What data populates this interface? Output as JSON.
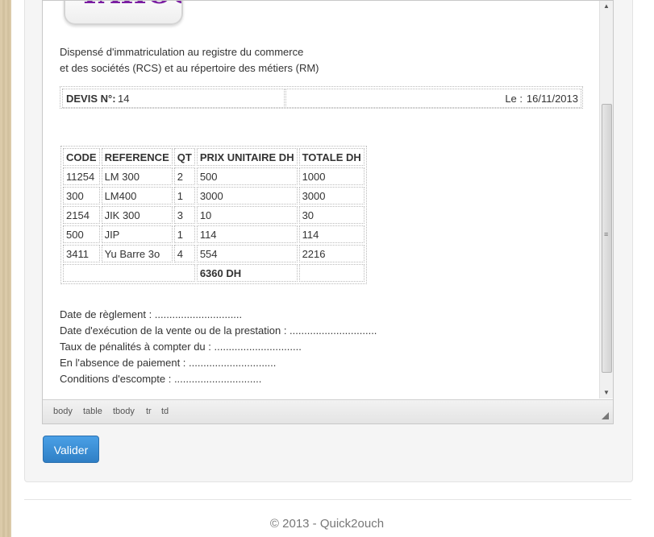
{
  "company": {
    "logo_text": "YAHOO!",
    "line1": "Dispensé d'immatriculation au registre du commerce",
    "line2": "et des sociétés (RCS) et au répertoire des métiers (RM)"
  },
  "devis": {
    "number_label": "DEVIS N°:",
    "number_value": "14",
    "date_label": "Le :",
    "date_value": "16/11/2013"
  },
  "items_table": {
    "headers": [
      "CODE",
      "REFERENCE",
      "QT",
      "PRIX UNITAIRE DH",
      "TOTALE DH"
    ],
    "rows": [
      [
        "11254",
        "LM 300",
        "2",
        "500",
        "1000"
      ],
      [
        "300",
        "LM400",
        "1",
        "3000",
        "3000"
      ],
      [
        "2154",
        "JIK 300",
        "3",
        "10",
        "30"
      ],
      [
        "500",
        "JIP",
        "1",
        "114",
        "114"
      ],
      [
        "3411",
        "Yu Barre 3o",
        "4",
        "554",
        "2216"
      ]
    ],
    "total": "6360 DH"
  },
  "terms": {
    "line1": "Date de règlement : ..............................",
    "line2": "Date d'exécution de la vente ou de la prestation : ..............................",
    "line3": "Taux de pénalités à compter du : ..............................",
    "line4": "En l'absence de paiement : ..............................",
    "line5": "Conditions d'escompte : .............................."
  },
  "editor_path": [
    "body",
    "table",
    "tbody",
    "tr",
    "td"
  ],
  "actions": {
    "submit_label": "Valider"
  },
  "footer": {
    "text": "© 2013 - Quick2ouch"
  },
  "colors": {
    "button": "#3a8fd6",
    "logo": "#7b1fa2",
    "background": "#d9c7a4"
  }
}
